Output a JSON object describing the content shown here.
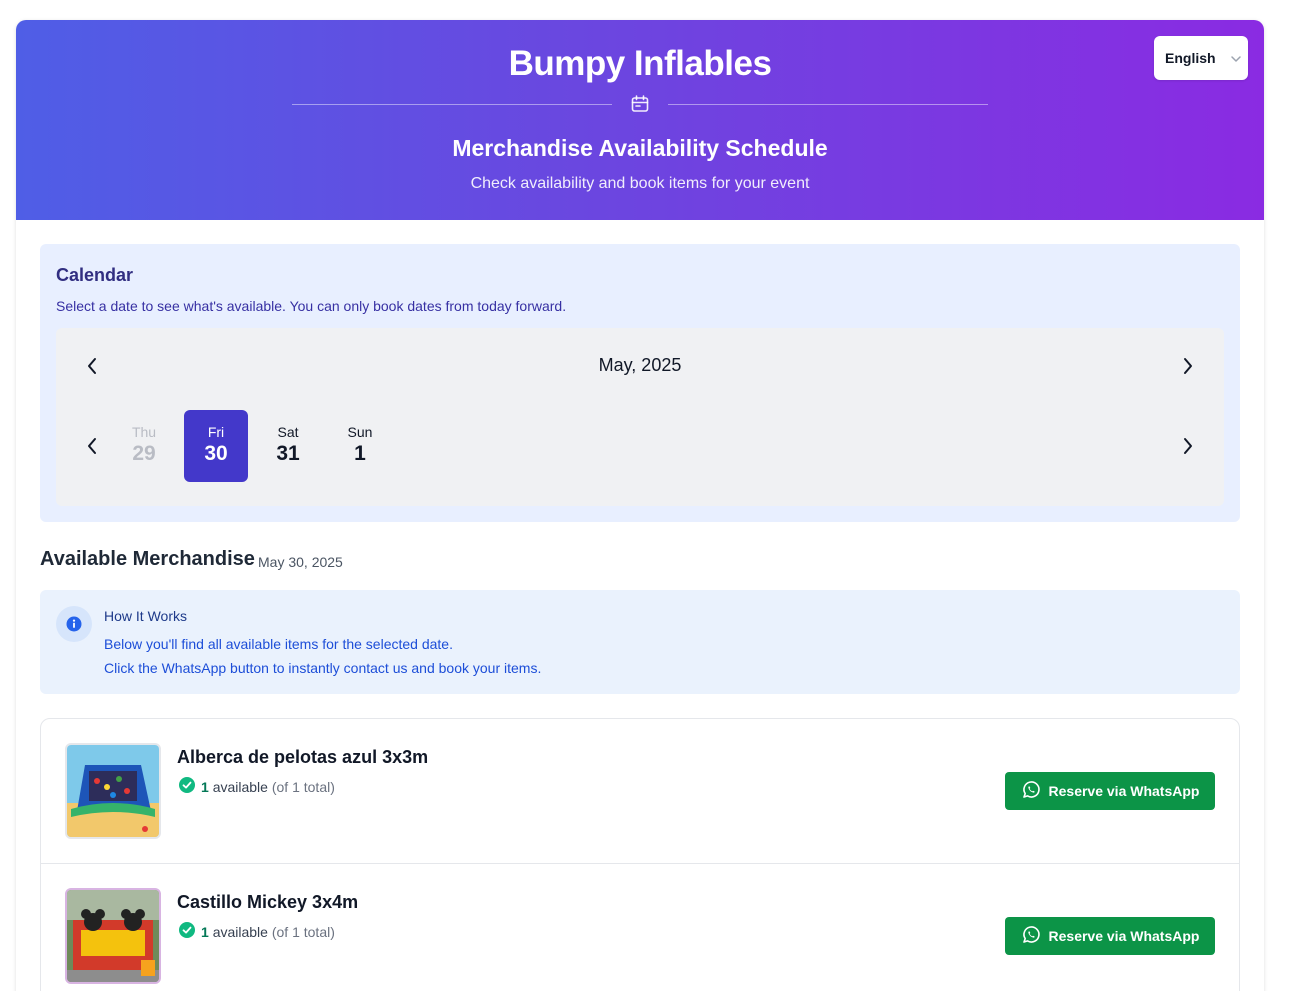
{
  "header": {
    "brand": "Bumpy Inflables",
    "title": "Merchandise Availability Schedule",
    "subtitle": "Check availability and book items for your event",
    "icon": "calendar-icon"
  },
  "language": {
    "selected": "English"
  },
  "calendar": {
    "heading": "Calendar",
    "help": "Select a date to see what's available. You can only book dates from today forward.",
    "month": "May, 2025",
    "days": [
      {
        "dow": "Thu",
        "num": "29",
        "state": "past"
      },
      {
        "dow": "Fri",
        "num": "30",
        "state": "selected"
      },
      {
        "dow": "Sat",
        "num": "31",
        "state": "normal"
      },
      {
        "dow": "Sun",
        "num": "1",
        "state": "normal"
      }
    ]
  },
  "merchandise": {
    "heading": "Available Merchandise",
    "date": "May 30, 2025"
  },
  "how_it_works": {
    "title": "How It Works",
    "line1": "Below you'll find all available items for the selected date.",
    "line2": "Click the WhatsApp button to instantly contact us and book your items."
  },
  "items": [
    {
      "name": "Alberca de pelotas azul 3x3m",
      "available": "1",
      "available_label": "available",
      "total": "(of 1 total)",
      "button": "Reserve via WhatsApp"
    },
    {
      "name": "Castillo Mickey 3x4m",
      "available": "1",
      "available_label": "available",
      "total": "(of 1 total)",
      "button": "Reserve via WhatsApp"
    }
  ],
  "colors": {
    "header_start": "#4f5ee6",
    "header_end": "#8a2be2",
    "selected_day": "#4338ca",
    "whatsapp": "#0c9447",
    "available_check": "#10b981"
  }
}
